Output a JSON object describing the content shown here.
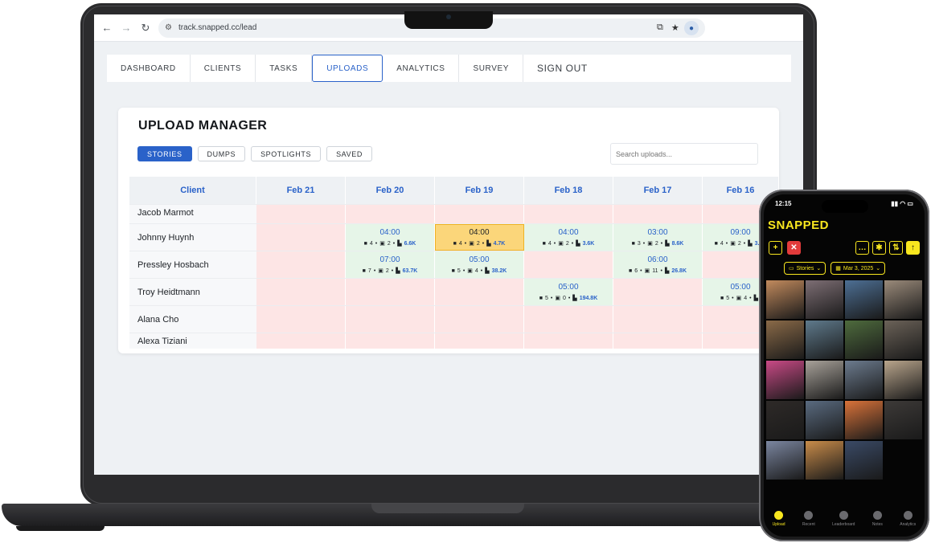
{
  "browser": {
    "url": "track.snapped.cc/lead",
    "back_icon": "arrow-left-icon",
    "forward_icon": "arrow-right-icon",
    "reload_icon": "reload-icon"
  },
  "nav": {
    "items": [
      "DASHBOARD",
      "CLIENTS",
      "TASKS",
      "UPLOADS",
      "ANALYTICS",
      "SURVEY"
    ],
    "active": "UPLOADS",
    "signout": "SIGN OUT"
  },
  "upload_manager": {
    "title": "UPLOAD MANAGER",
    "filters": [
      "STORIES",
      "DUMPS",
      "SPOTLIGHTS",
      "SAVED"
    ],
    "active_filter": "STORIES",
    "search_placeholder": "Search uploads...",
    "columns": [
      "Client",
      "Feb 21",
      "Feb 20",
      "Feb 19",
      "Feb 18",
      "Feb 17",
      "Feb 16"
    ],
    "rows": [
      {
        "client": "Jacob Marmot",
        "cells": [
          null,
          null,
          null,
          null,
          null,
          null
        ]
      },
      {
        "client": "Johnny Huynh",
        "cells": [
          null,
          {
            "time": "04:00",
            "videos": "4",
            "photos": "2",
            "views": "6.6K"
          },
          {
            "time": "04:00",
            "videos": "4",
            "photos": "2",
            "views": "4.7K",
            "selected": true
          },
          {
            "time": "04:00",
            "videos": "4",
            "photos": "2",
            "views": "3.6K"
          },
          {
            "time": "03:00",
            "videos": "3",
            "photos": "2",
            "views": "8.6K"
          },
          {
            "time": "09:00",
            "videos": "4",
            "photos": "2",
            "views": "3.8K"
          }
        ]
      },
      {
        "client": "Pressley Hosbach",
        "cells": [
          null,
          {
            "time": "07:00",
            "videos": "7",
            "photos": "2",
            "views": "63.7K"
          },
          {
            "time": "05:00",
            "videos": "5",
            "photos": "4",
            "views": "38.2K"
          },
          null,
          {
            "time": "06:00",
            "videos": "6",
            "photos": "11",
            "views": "26.8K"
          },
          null
        ]
      },
      {
        "client": "Troy Heidtmann",
        "cells": [
          null,
          null,
          null,
          {
            "time": "05:00",
            "videos": "5",
            "photos": "0",
            "views": "194.8K"
          },
          null,
          {
            "time": "05:00",
            "videos": "5",
            "photos": "4",
            "views": ""
          }
        ]
      },
      {
        "client": "Alana Cho",
        "cells": [
          null,
          null,
          null,
          null,
          null,
          null
        ]
      },
      {
        "client": "Alexa Tiziani",
        "cells": [
          null,
          null,
          null,
          null,
          null,
          null
        ]
      }
    ]
  },
  "phone": {
    "time": "12:15",
    "brand": "SNAPPED",
    "select_type": "Stories",
    "select_date": "Mar 3, 2025",
    "tabs": [
      "Upload",
      "Recent",
      "Leaderboard",
      "Notes",
      "Analytics"
    ],
    "active_tab": "Upload",
    "photo_colors": [
      "#c28a5d",
      "#7d6e74",
      "#4d6f94",
      "#9a8a7a",
      "#8a6a48",
      "#5f7a8c",
      "#4e6b3d",
      "#6b6258",
      "#c94a86",
      "#a8a29a",
      "#6c7b8e",
      "#b9a58c",
      "#2e2a28",
      "#5a6b80",
      "#d9733a",
      "#3d3a38",
      "#7b86a0",
      "#c98c4a",
      "#3a4a66"
    ]
  },
  "colors": {
    "accent": "#2a62c9",
    "empty_cell": "#fde5e5",
    "filled_cell": "#e6f5e8",
    "selected_cell": "#fbd67a",
    "phone_accent": "#f9e71f"
  }
}
